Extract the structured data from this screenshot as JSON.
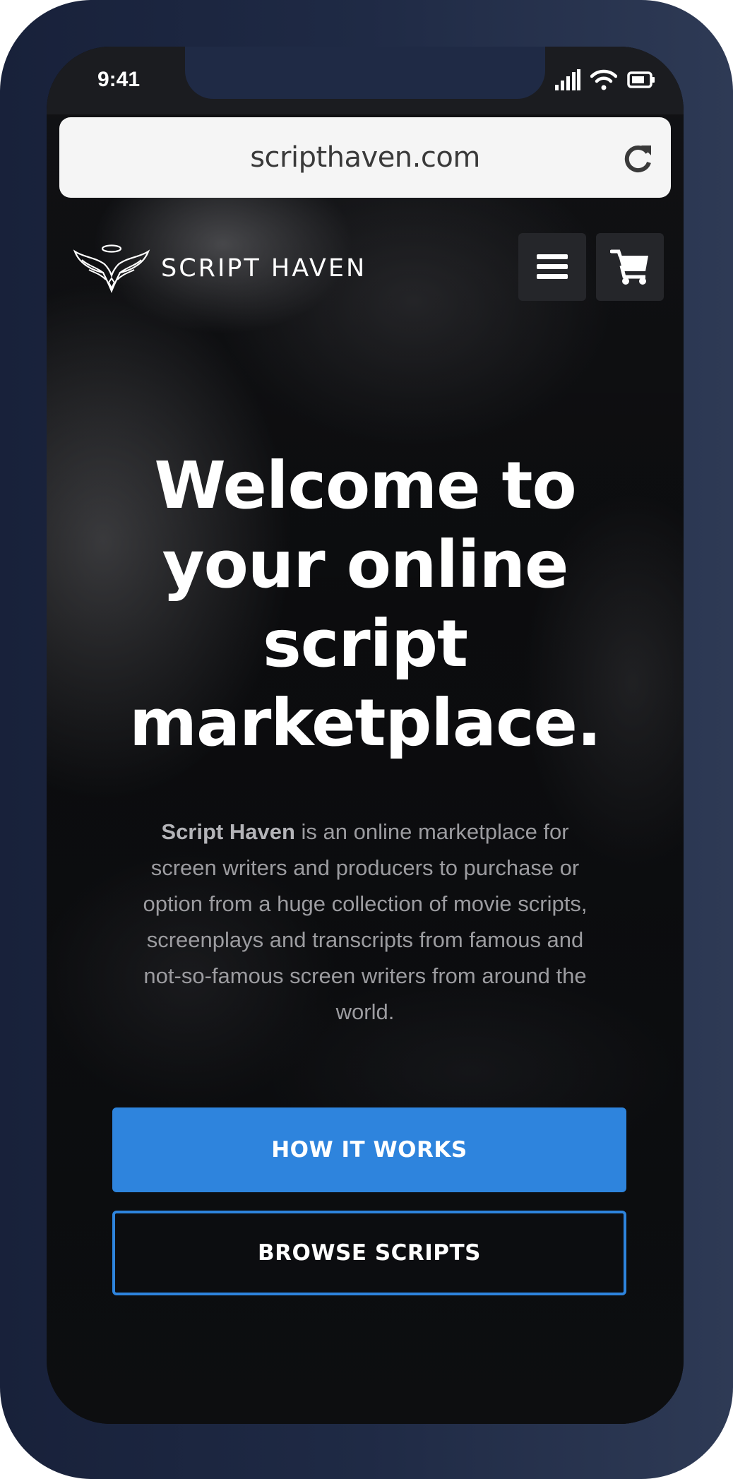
{
  "status_bar": {
    "time": "9:41",
    "icons": [
      "cellular-signal-icon",
      "wifi-icon",
      "battery-icon"
    ]
  },
  "browser": {
    "url": "scripthaven.com",
    "reload_icon": "reload-icon"
  },
  "navbar": {
    "brand": "SCRIPT HAVEN",
    "logo_icon": "winged-halo-logo-icon",
    "menu_icon": "hamburger-menu-icon",
    "cart_icon": "shopping-cart-icon"
  },
  "hero": {
    "headline_lines": [
      "Welcome to",
      "your online",
      "script",
      "marketplace."
    ],
    "description_bold": "Script Haven",
    "description_rest": " is an online marketplace for screen writers and producers to purchase or option from a huge collection of movie scripts, screenplays and transcripts from famous and not-so-famous screen writers from around the world.",
    "primary_button": "HOW IT WORKS",
    "secondary_button": "BROWSE SCRIPTS"
  },
  "colors": {
    "accent": "#2e84dd",
    "device_frame": "#1f2a45",
    "url_bar": "#f5f5f5"
  }
}
